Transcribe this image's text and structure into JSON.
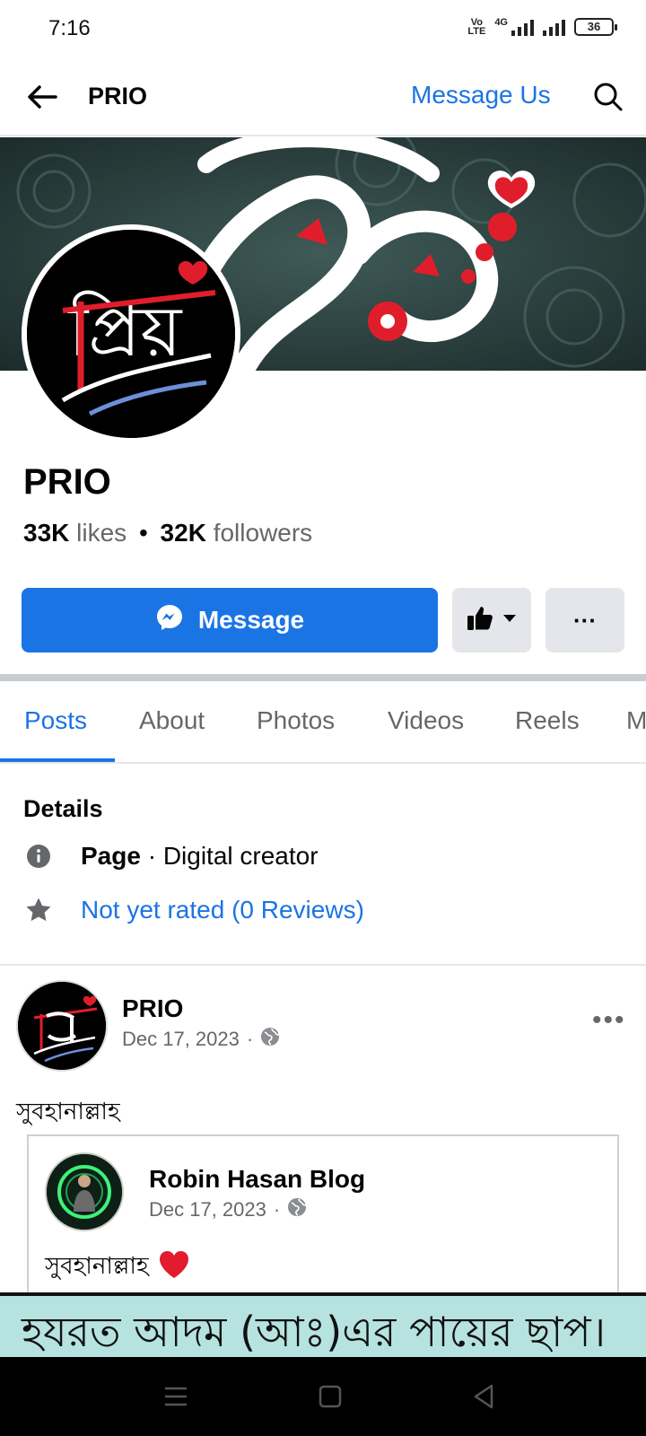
{
  "status_bar": {
    "time": "7:16",
    "volte": "Vo LTE",
    "network": "4G",
    "battery": "36"
  },
  "topbar": {
    "title": "PRIO",
    "message_us": "Message Us"
  },
  "profile": {
    "name": "PRIO",
    "likes_count": "33K",
    "likes_label": "likes",
    "separator": "•",
    "followers_count": "32K",
    "followers_label": "followers",
    "logo_text": "প্রিয়"
  },
  "actions": {
    "message_label": "Message",
    "more_label": "···"
  },
  "tabs": [
    "Posts",
    "About",
    "Photos",
    "Videos",
    "Reels",
    "M"
  ],
  "details": {
    "title": "Details",
    "page_label": "Page",
    "page_category": " · Digital creator",
    "rating": "Not yet rated (0 Reviews)"
  },
  "post": {
    "author": "PRIO",
    "date": "Dec 17, 2023",
    "dot": "·",
    "text": "সুবহানাল্লাহ",
    "menu": "•••",
    "shared": {
      "author": "Robin Hasan Blog",
      "date": "Dec 17, 2023",
      "dot": "·",
      "text": "সুবহানাল্লাহ",
      "emoji": "❤️"
    }
  },
  "banner": {
    "text": "হযরত আদম (আঃ)এর পায়ের ছাপ।"
  },
  "colors": {
    "accent": "#1b74e4",
    "secondary_text": "#65676b",
    "button_gray": "#e4e6eb",
    "banner_bg": "#b6e3df"
  },
  "icons": [
    "back-arrow-icon",
    "search-icon",
    "messenger-icon",
    "thumbs-up-icon",
    "caret-down-icon",
    "info-icon",
    "star-icon",
    "globe-icon",
    "menu-icon",
    "home-icon",
    "back-icon"
  ]
}
